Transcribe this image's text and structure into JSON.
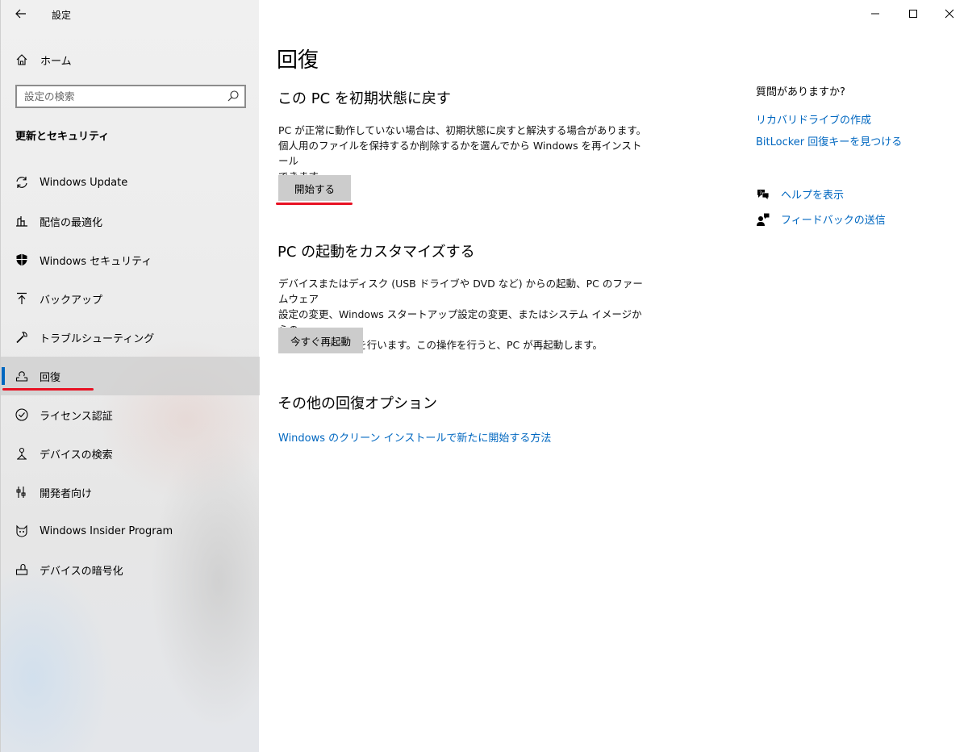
{
  "window": {
    "title": "設定",
    "minimize_icon": "minimize-icon",
    "maximize_icon": "maximize-icon",
    "close_icon": "close-icon"
  },
  "sidebar": {
    "home_label": "ホーム",
    "search_placeholder": "設定の検索",
    "section_label": "更新とセキュリティ",
    "items": [
      {
        "label": "Windows Update",
        "icon": "sync-icon"
      },
      {
        "label": "配信の最適化",
        "icon": "delivery-optimization-icon"
      },
      {
        "label": "Windows セキュリティ",
        "icon": "shield-icon"
      },
      {
        "label": "バックアップ",
        "icon": "backup-arrow-icon"
      },
      {
        "label": "トラブルシューティング",
        "icon": "wrench-icon"
      },
      {
        "label": "回復",
        "icon": "recovery-icon",
        "selected": true
      },
      {
        "label": "ライセンス認証",
        "icon": "check-circle-icon"
      },
      {
        "label": "デバイスの検索",
        "icon": "find-device-icon"
      },
      {
        "label": "開発者向け",
        "icon": "developer-tools-icon"
      },
      {
        "label": "Windows Insider Program",
        "icon": "insider-cat-icon"
      },
      {
        "label": "デバイスの暗号化",
        "icon": "encryption-icon"
      }
    ]
  },
  "main": {
    "title": "回復",
    "reset": {
      "heading": "この PC を初期状態に戻す",
      "line1": "PC が正常に動作していない場合は、初期状態に戻すと解決する場合があります。",
      "line2": "個人用のファイルを保持するか削除するかを選んでから Windows を再インストール",
      "line3": "できます。",
      "button": "開始する"
    },
    "startup": {
      "heading": "PC の起動をカスタマイズする",
      "line1": "デバイスまたはディスク (USB ドライブや DVD など) からの起動、PC のファームウェア",
      "line2": "設定の変更、Windows スタートアップ設定の変更、またはシステム イメージからの",
      "line3": "Windows の復元を行います。この操作を行うと、PC が再起動します。",
      "button": "今すぐ再起動"
    },
    "other": {
      "heading": "その他の回復オプション",
      "link": "Windows のクリーン インストールで新たに開始する方法"
    }
  },
  "right": {
    "heading": "質問がありますか?",
    "links": [
      "リカバリドライブの作成",
      "BitLocker 回復キーを見つける"
    ],
    "help_label": "ヘルプを表示",
    "feedback_label": "フィードバックの送信"
  }
}
